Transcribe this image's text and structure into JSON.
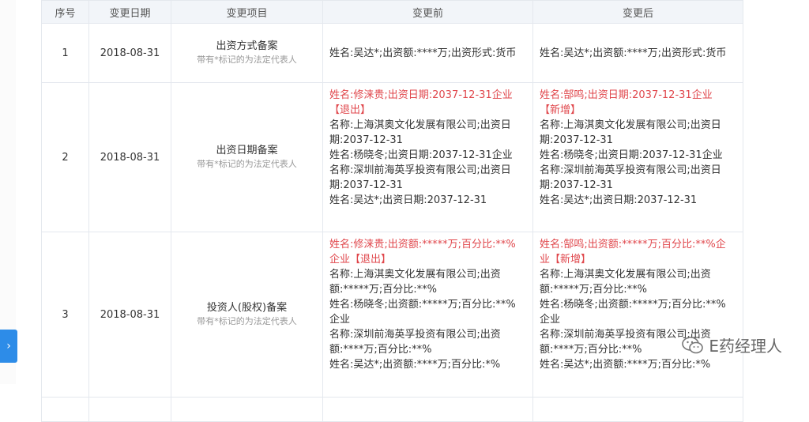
{
  "headers": [
    "序号",
    "变更日期",
    "变更项目",
    "变更前",
    "变更后"
  ],
  "rows": [
    {
      "index": "1",
      "date": "2018-08-31",
      "item": "出资方式备案",
      "note": "带有*标记的为法定代表人",
      "before": [
        {
          "text": "姓名:吴达*;出资额:****万;出资形式:货币",
          "red": false
        }
      ],
      "after": [
        {
          "text": "姓名:吴达*;出资额:****万;出资形式:货币",
          "red": false
        }
      ]
    },
    {
      "index": "2",
      "date": "2018-08-31",
      "item": "出资日期备案",
      "note": "带有*标记的为法定代表人",
      "before": [
        {
          "text": "姓名:修涞贵;出资日期:2037-12-31企业",
          "red": true
        },
        {
          "text": "【退出】",
          "red": true
        },
        {
          "text": "名称:上海淇奥文化发展有限公司;出资日",
          "red": false
        },
        {
          "text": "期:2037-12-31",
          "red": false
        },
        {
          "text": "姓名:杨晓冬;出资日期:2037-12-31企业",
          "red": false
        },
        {
          "text": "名称:深圳前海英孚投资有限公司;出资日",
          "red": false
        },
        {
          "text": "期:2037-12-31",
          "red": false
        },
        {
          "text": "姓名:吴达*;出资日期:2037-12-31",
          "red": false
        }
      ],
      "after": [
        {
          "text": "姓名:郜鸣;出资日期:2037-12-31企业",
          "red": true
        },
        {
          "text": "【新增】",
          "red": true
        },
        {
          "text": "名称:上海淇奥文化发展有限公司;出资日",
          "red": false
        },
        {
          "text": "期:2037-12-31",
          "red": false
        },
        {
          "text": "姓名:杨晓冬;出资日期:2037-12-31企业",
          "red": false
        },
        {
          "text": "名称:深圳前海英孚投资有限公司;出资日",
          "red": false
        },
        {
          "text": "期:2037-12-31",
          "red": false
        },
        {
          "text": "姓名:吴达*;出资日期:2037-12-31",
          "red": false
        }
      ]
    },
    {
      "index": "3",
      "date": "2018-08-31",
      "item": "投资人(股权)备案",
      "note": "带有*标记的为法定代表人",
      "before": [
        {
          "text": "姓名:修涞贵;出资额:*****万;百分比:**%",
          "red": true
        },
        {
          "text": "企业【退出】",
          "red": true
        },
        {
          "text": "名称:上海淇奥文化发展有限公司;出资",
          "red": false
        },
        {
          "text": "额:*****万;百分比:**%",
          "red": false
        },
        {
          "text": "姓名:杨晓冬;出资额:*****万;百分比:**%",
          "red": false
        },
        {
          "text": "企业",
          "red": false
        },
        {
          "text": "名称:深圳前海英孚投资有限公司;出资",
          "red": false
        },
        {
          "text": "额:****万;百分比:**%",
          "red": false
        },
        {
          "text": "姓名:吴达*;出资额:****万;百分比:*%",
          "red": false
        }
      ],
      "after": [
        {
          "text": "姓名:郜鸣;出资额:*****万;百分比:**%企",
          "red": true
        },
        {
          "text": "业【新增】",
          "red": true
        },
        {
          "text": "名称:上海淇奥文化发展有限公司;出资",
          "red": false
        },
        {
          "text": "额:*****万;百分比:**%",
          "red": false
        },
        {
          "text": "姓名:杨晓冬;出资额:*****万;百分比:**%",
          "red": false
        },
        {
          "text": "企业",
          "red": false
        },
        {
          "text": "名称:深圳前海英孚投资有限公司;出资",
          "red": false
        },
        {
          "text": "额:****万;百分比:**%",
          "red": false
        },
        {
          "text": "姓名:吴达*;出资额:****万;百分比:*%",
          "red": false
        }
      ]
    }
  ],
  "watermark": "E药经理人",
  "colors": {
    "red": "#e0474c",
    "header_bg": "#f2f5f9",
    "border": "#e4e8ee",
    "tab_blue": "#2d8ce8"
  },
  "icons": {
    "side_tab": "chevron-right-icon",
    "watermark": "wechat-icon"
  }
}
